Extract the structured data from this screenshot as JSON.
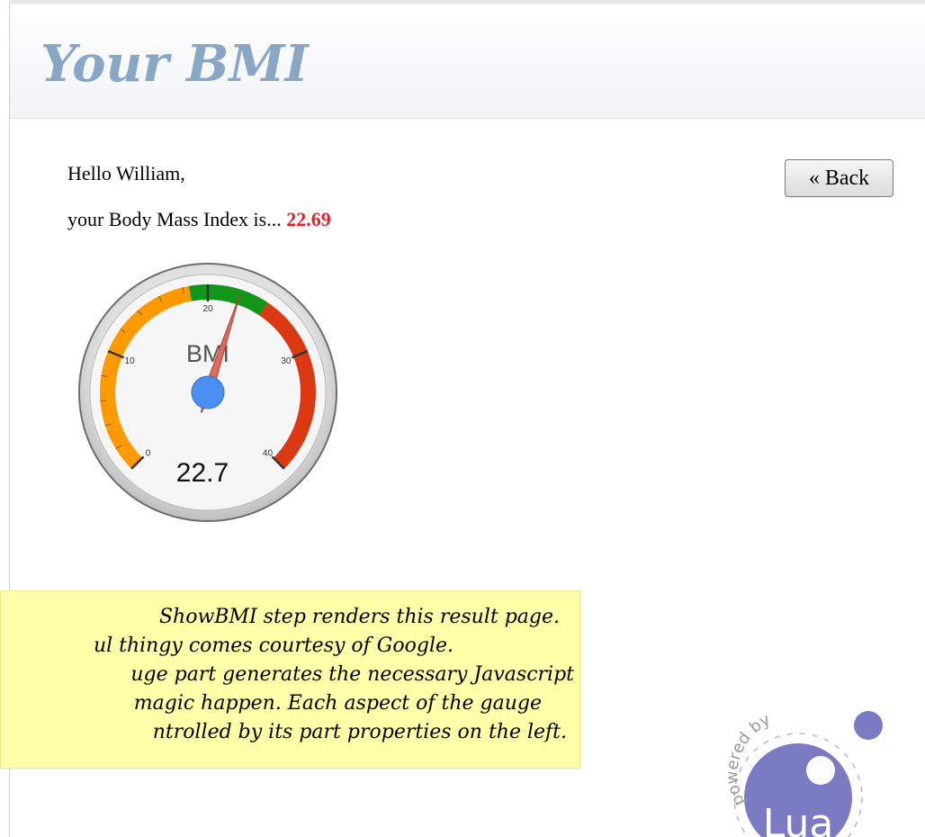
{
  "header": {
    "title": "Your BMI"
  },
  "content": {
    "greeting": "Hello William,",
    "bmi_prefix": "your Body Mass Index is...",
    "bmi_value": "22.69",
    "back_button": "« Back"
  },
  "gauge": {
    "label": "BMI",
    "display_value": "22.7",
    "value": 22.69,
    "min": 0,
    "max": 40,
    "ticks": [
      "0",
      "10",
      "20",
      "30",
      "40"
    ],
    "bands": [
      {
        "from": 0,
        "to": 18.5,
        "color": "#ff9900"
      },
      {
        "from": 18.5,
        "to": 25,
        "color": "#109618"
      },
      {
        "from": 25,
        "to": 40,
        "color": "#dc3912"
      }
    ]
  },
  "note": {
    "lines": [
      "ShowBMI step renders this result page.",
      "ul thingy comes courtesy of Google.",
      "uge part generates the necessary Javascript",
      "magic happen. Each aspect of the gauge",
      "ntrolled by its part properties on the left."
    ]
  },
  "logo": {
    "powered_by": "powered by",
    "name": "Lua"
  },
  "colors": {
    "title": "#8aa6c5",
    "bmi_value": "#e8202a",
    "note_bg": "#ffffaa",
    "lua": "#8080c8"
  }
}
